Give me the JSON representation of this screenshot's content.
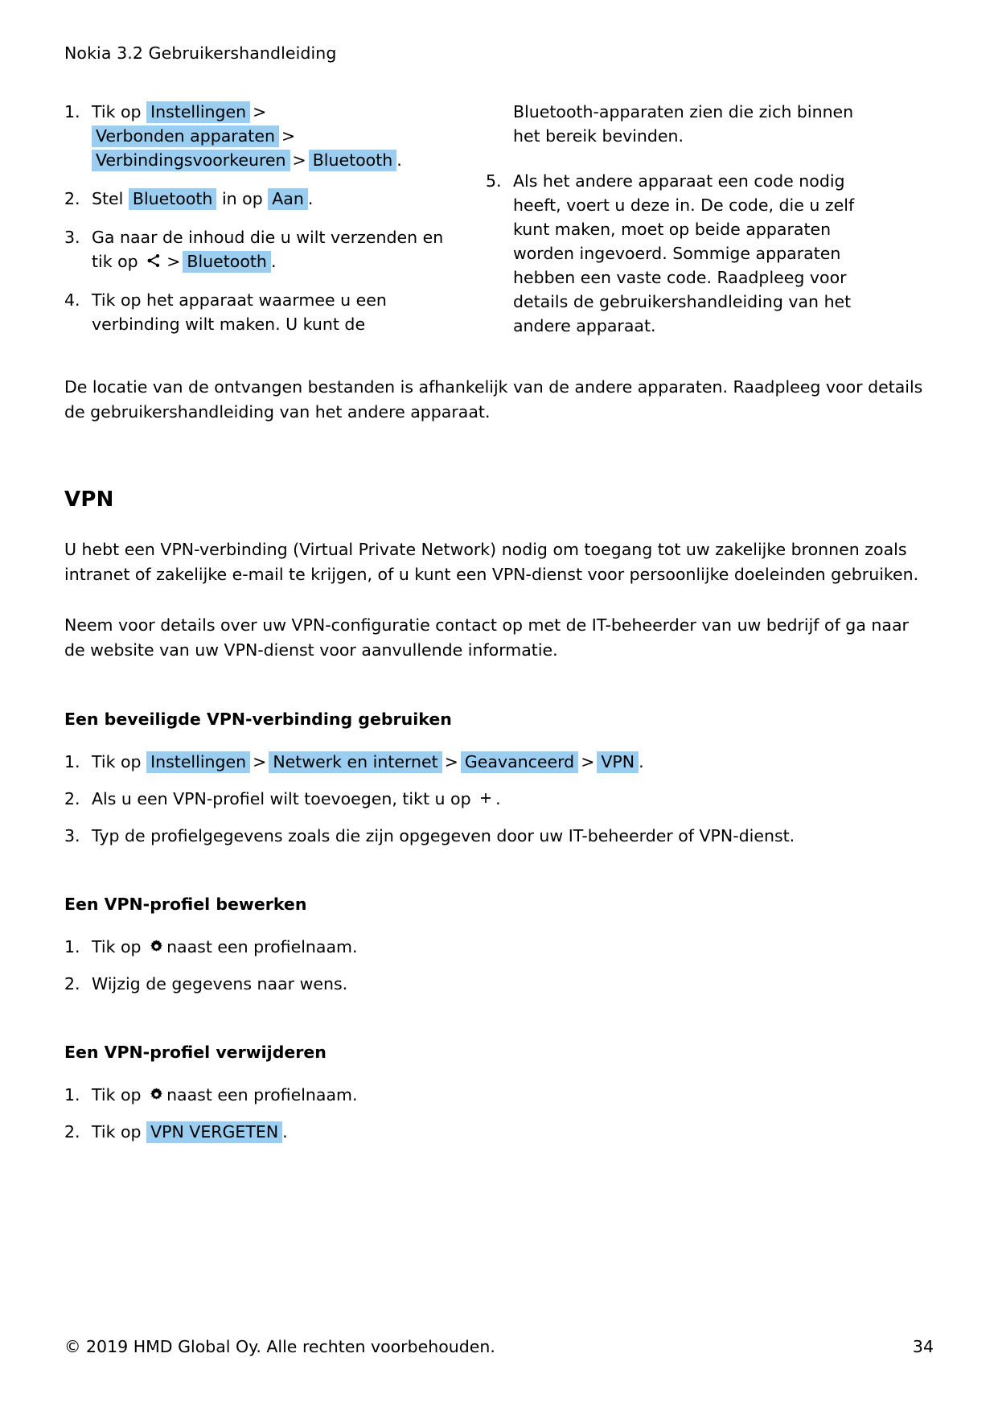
{
  "header": {
    "running_head": "Nokia 3.2 Gebruikershandleiding"
  },
  "bluetooth_steps": {
    "left_column": [
      {
        "number": "1.",
        "prefix": "Tik op",
        "chips": [
          "Instellingen",
          "Verbonden apparaten",
          "Verbindingsvoorkeuren",
          "Bluetooth"
        ],
        "separator": ">",
        "suffix": "."
      },
      {
        "number": "2.",
        "prefix": "Stel",
        "chip_a": "Bluetooth",
        "middle": "in op",
        "chip_b": "Aan",
        "suffix": "."
      },
      {
        "number": "3.",
        "line1": "Ga naar de inhoud die u wilt verzenden en",
        "line2_prefix": "tik op",
        "icon": "share-icon",
        "separator": ">",
        "chip": "Bluetooth",
        "suffix": "."
      },
      {
        "number": "4.",
        "text": "Tik op het apparaat waarmee u een verbinding wilt maken. U kunt de"
      }
    ],
    "right_column": {
      "continuation": "Bluetooth-apparaten zien die zich binnen het bereik bevinden.",
      "step5": {
        "number": "5.",
        "text": "Als het andere apparaat een code nodig heeft, voert u deze in. De code, die u zelf kunt maken, moet op beide apparaten worden ingevoerd. Sommige apparaten hebben een vaste code. Raadpleeg voor details de gebruikershandleiding van het andere apparaat."
      }
    }
  },
  "note": "De locatie van de ontvangen bestanden is afhankelijk van de andere apparaten. Raadpleeg voor details de gebruikershandleiding van het andere apparaat.",
  "vpn": {
    "heading": "VPN",
    "paragraph_1": "U hebt een VPN-verbinding (Virtual Private Network) nodig om toegang tot uw zakelijke bronnen zoals intranet of zakelijke e-mail te krijgen, of u kunt een VPN-dienst voor persoonlijke doeleinden gebruiken.",
    "paragraph_2": "Neem voor details over uw VPN-configuratie contact op met de IT-beheerder van uw bedrijf of ga naar de website van uw VPN-dienst voor aanvullende informatie.",
    "secure_connection": {
      "heading": "Een beveiligde VPN-verbinding gebruiken",
      "step1": {
        "number": "1.",
        "prefix": "Tik op",
        "chips": [
          "Instellingen",
          "Netwerk en internet",
          "Geavanceerd",
          "VPN"
        ],
        "separator": ">",
        "suffix": "."
      },
      "step2": {
        "number": "2.",
        "prefix": "Als u een VPN-profiel wilt toevoegen, tikt u op",
        "icon": "plus-icon",
        "suffix": "."
      },
      "step3": {
        "number": "3.",
        "text": "Typ de profielgegevens zoals die zijn opgegeven door uw IT-beheerder of VPN-dienst."
      }
    },
    "edit_profile": {
      "heading": "Een VPN-profiel bewerken",
      "step1": {
        "number": "1.",
        "prefix": "Tik op",
        "icon": "gear-icon",
        "suffix": "naast een profielnaam."
      },
      "step2": {
        "number": "2.",
        "text": "Wijzig de gegevens naar wens."
      }
    },
    "delete_profile": {
      "heading": "Een VPN-profiel verwijderen",
      "step1": {
        "number": "1.",
        "prefix": "Tik op",
        "icon": "gear-icon",
        "suffix": "naast een profielnaam."
      },
      "step2": {
        "number": "2.",
        "prefix": "Tik op",
        "chip": "VPN VERGETEN",
        "suffix": "."
      }
    }
  },
  "footer": {
    "copyright": "© 2019 HMD Global Oy. Alle rechten voorbehouden.",
    "page_number": "34"
  },
  "colors": {
    "highlight": "#9bcdf0",
    "text": "#000000",
    "background": "#ffffff"
  }
}
